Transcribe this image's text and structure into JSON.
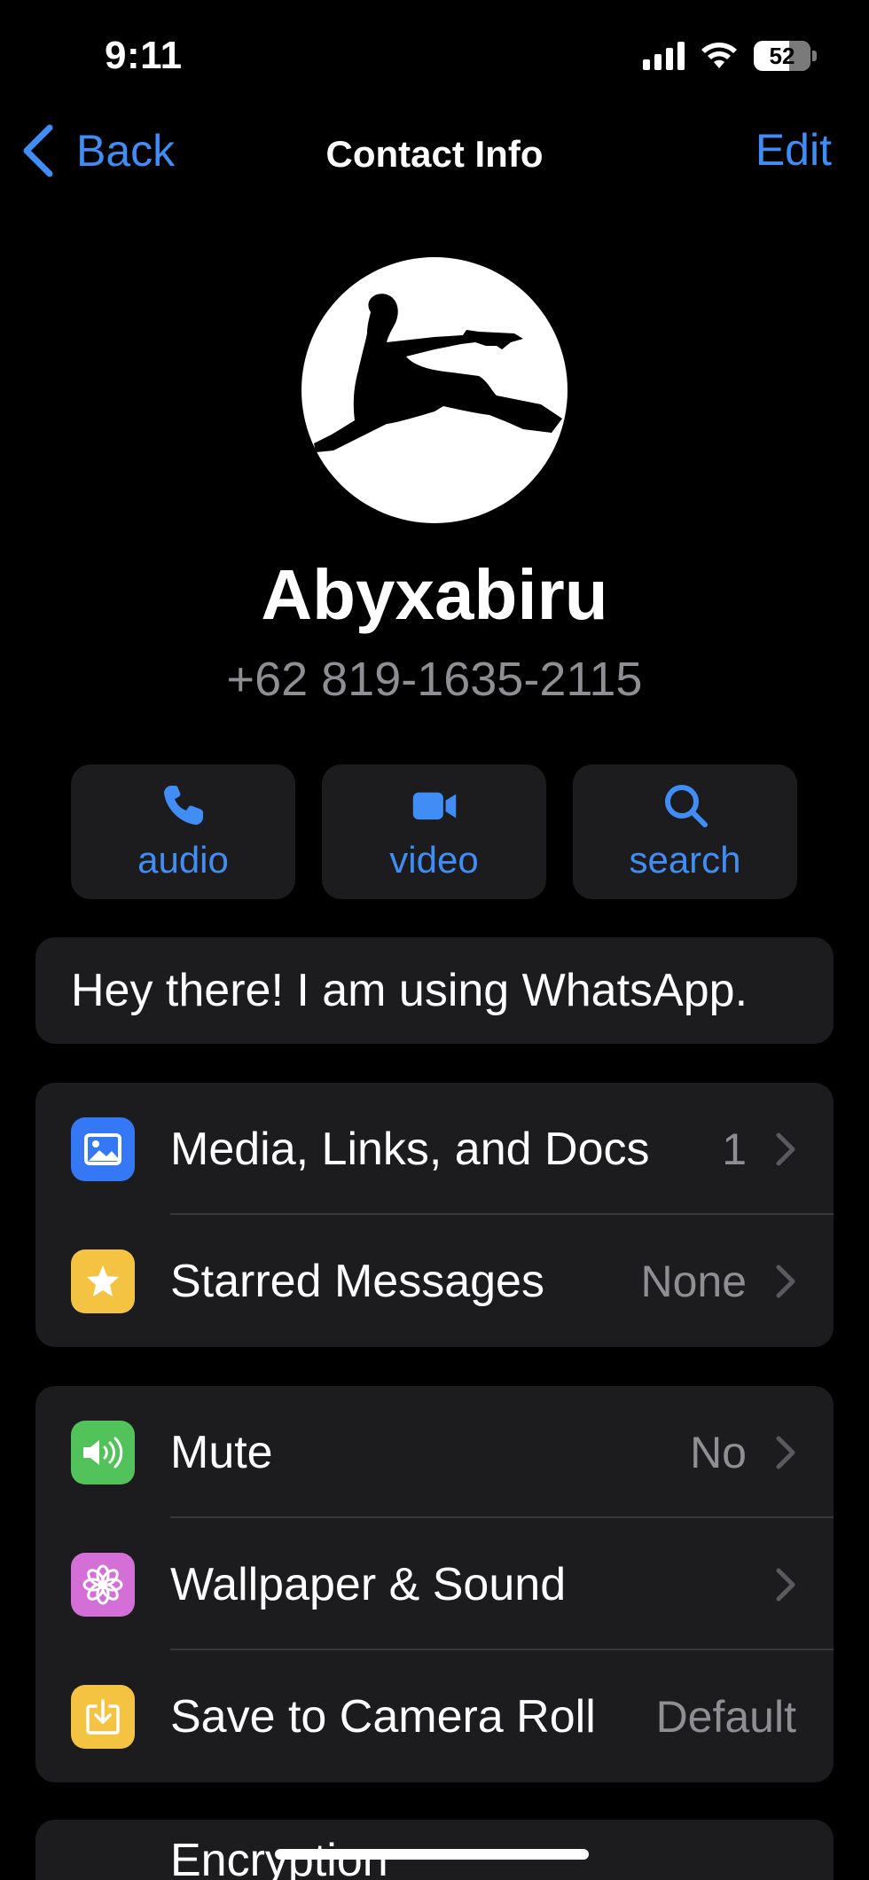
{
  "status_bar": {
    "time": "9:11",
    "battery": "52"
  },
  "nav": {
    "back_label": "Back",
    "title": "Contact Info",
    "edit_label": "Edit"
  },
  "contact": {
    "name": "Abyxabiru",
    "phone": "+62 819-1635-2115"
  },
  "actions": [
    {
      "label": "audio",
      "icon": "phone-icon"
    },
    {
      "label": "video",
      "icon": "video-camera-icon"
    },
    {
      "label": "search",
      "icon": "search-icon"
    }
  ],
  "about": "Hey there! I am using WhatsApp.",
  "group1": [
    {
      "label": "Media, Links, and Docs",
      "value": "1",
      "icon": "photo-icon",
      "color": "#3478f6"
    },
    {
      "label": "Starred Messages",
      "value": "None",
      "icon": "star-icon",
      "color": "#f5c342"
    }
  ],
  "group2": [
    {
      "label": "Mute",
      "value": "No",
      "icon": "speaker-icon",
      "color": "#52c35b"
    },
    {
      "label": "Wallpaper & Sound",
      "value": "",
      "icon": "flower-icon",
      "color": "#d36fd6"
    },
    {
      "label": "Save to Camera Roll",
      "value": "Default",
      "icon": "download-icon",
      "color": "#f5c342"
    }
  ],
  "group3": [
    {
      "label": "Encryption"
    }
  ],
  "colors": {
    "accent": "#3f8df5",
    "background": "#000000",
    "cell": "#1c1c1e",
    "secondary_text": "#8e8e93"
  }
}
